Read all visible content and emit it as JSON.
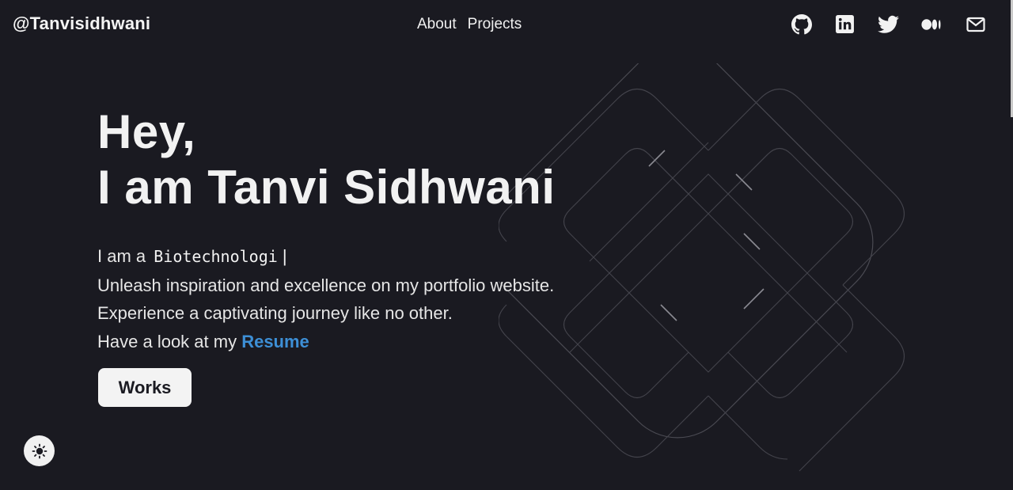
{
  "header": {
    "brand": "@Tanvisidhwani",
    "nav": [
      {
        "label": "About"
      },
      {
        "label": "Projects"
      }
    ],
    "socials": [
      "github-icon",
      "linkedin-icon",
      "twitter-icon",
      "medium-icon",
      "mail-icon"
    ]
  },
  "hero": {
    "greeting": "Hey,",
    "name_line": "I am Tanvi Sidhwani",
    "intro_prefix": "I am a",
    "typed_text": "Biotechnologi",
    "cursor": "|",
    "line2": "Unleash inspiration and excellence on my portfolio website.",
    "line3": "Experience a captivating journey like no other.",
    "line4_prefix": "Have a look at my",
    "resume_link": "Resume",
    "works_button": "Works"
  },
  "theme_toggle": {
    "icon": "sun-icon"
  },
  "colors": {
    "background": "#1a1a21",
    "text": "#ececec",
    "link": "#3d8fd6",
    "button_bg": "#f3f3f3"
  }
}
